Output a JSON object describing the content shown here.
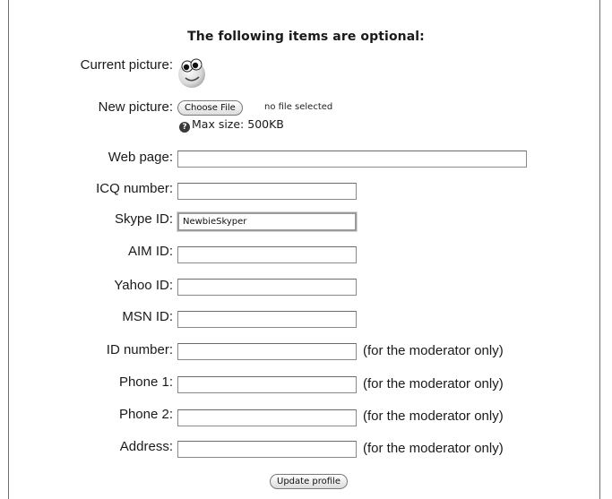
{
  "section": {
    "heading": "The following items are optional:"
  },
  "current_picture": {
    "label": "Current picture:",
    "icon": "smiley-face-icon"
  },
  "new_picture": {
    "label": "New picture:",
    "button_label": "Choose File",
    "file_status": "no file selected",
    "max_size_text": "Max size: 500KB",
    "help_icon": "?"
  },
  "fields": {
    "web_page": {
      "label": "Web page:",
      "value": ""
    },
    "icq": {
      "label": "ICQ number:",
      "value": ""
    },
    "skype": {
      "label": "Skype ID:",
      "value": "NewbieSkyper"
    },
    "aim": {
      "label": "AIM ID:",
      "value": ""
    },
    "yahoo": {
      "label": "Yahoo ID:",
      "value": ""
    },
    "msn": {
      "label": "MSN ID:",
      "value": ""
    },
    "id_number": {
      "label": "ID number:",
      "value": "",
      "note": "(for the moderator only)"
    },
    "phone1": {
      "label": "Phone 1:",
      "value": "",
      "note": "(for the moderator only)"
    },
    "phone2": {
      "label": "Phone 2:",
      "value": "",
      "note": "(for the moderator only)"
    },
    "address": {
      "label": "Address:",
      "value": "",
      "note": "(for the moderator only)"
    }
  },
  "actions": {
    "update_label": "Update profile"
  }
}
